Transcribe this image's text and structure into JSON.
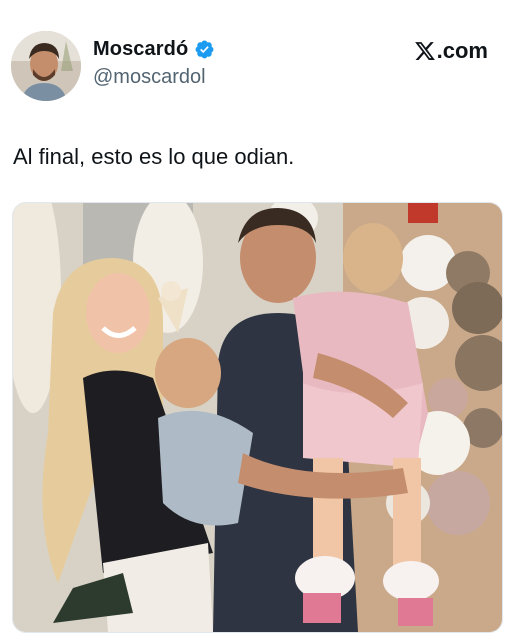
{
  "author": {
    "display_name": "Moscardó",
    "handle": "@moscardol",
    "verified": true,
    "avatar_icon": "profile-photo"
  },
  "site_label": ".com",
  "site_icon": "x-logo-icon",
  "tweet": {
    "text": "Al final, esto es lo que odian."
  },
  "media": {
    "type": "photo",
    "icon": "family-photo"
  },
  "colors": {
    "verified_blue": "#1d9bf0",
    "text_primary": "#0f1419",
    "text_secondary": "#536471"
  }
}
